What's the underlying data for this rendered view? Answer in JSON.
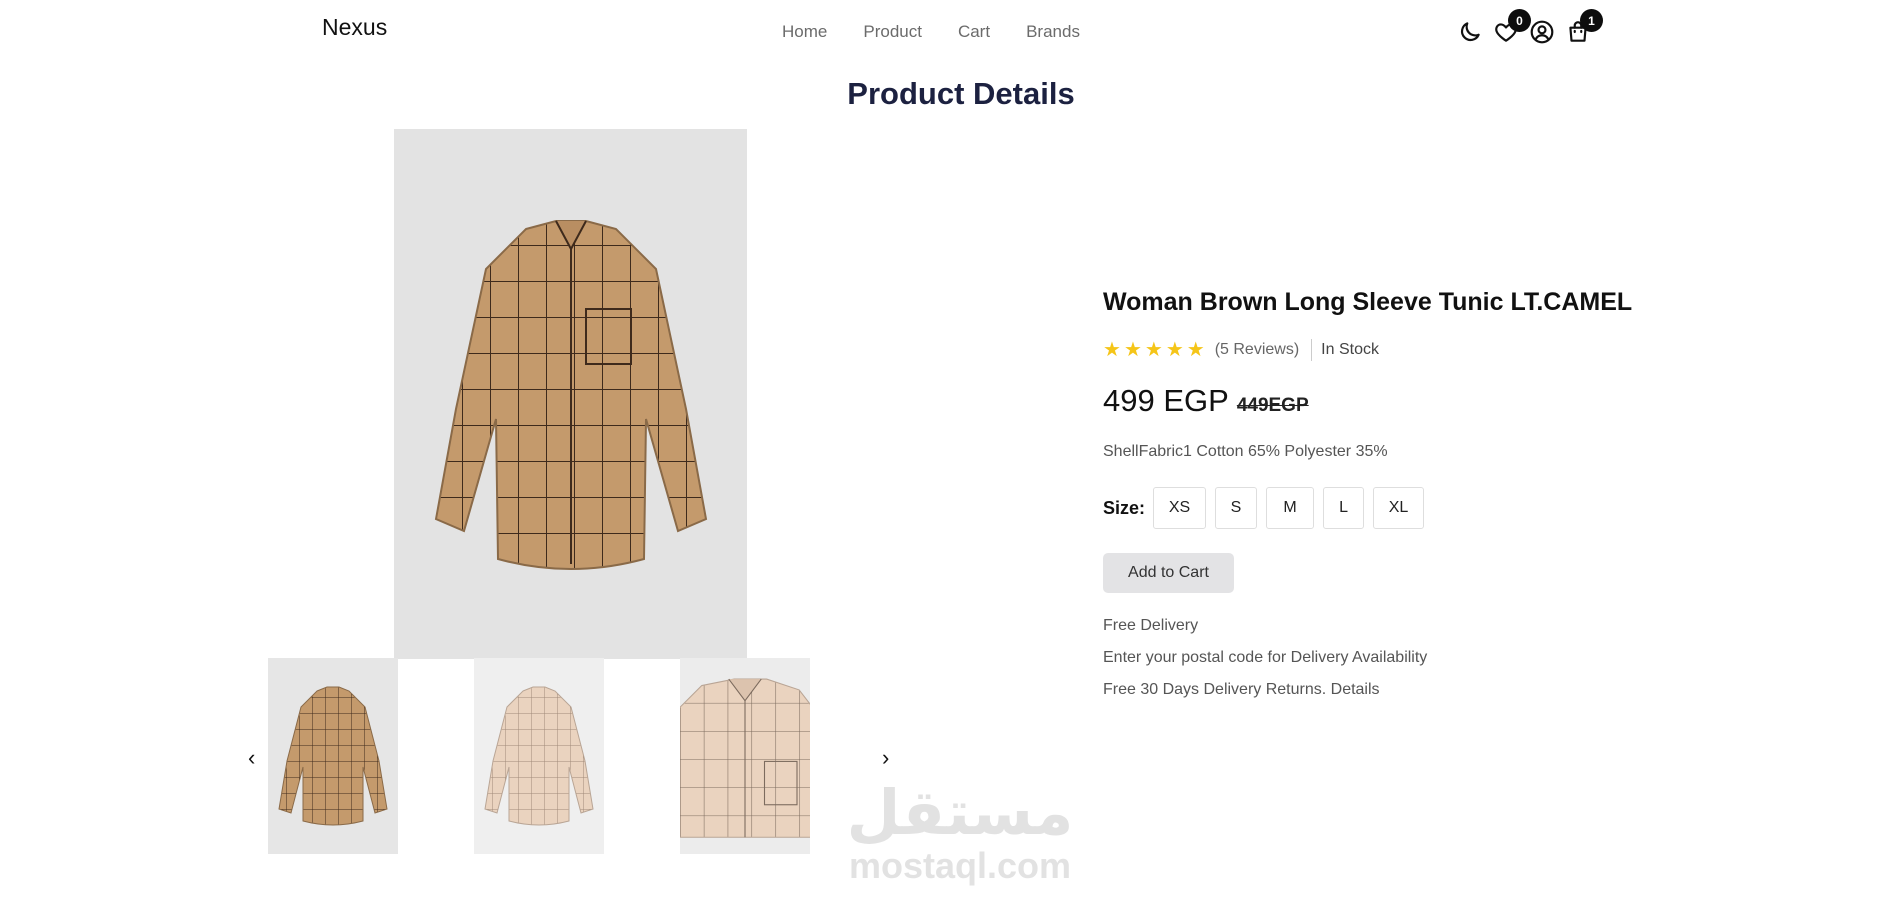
{
  "header": {
    "brand": "Nexus",
    "nav": [
      "Home",
      "Product",
      "Cart",
      "Brands"
    ],
    "wishlist_count": "0",
    "cart_count": "1"
  },
  "page": {
    "title": "Product Details"
  },
  "gallery": {
    "prev_arrow": "‹",
    "next_arrow": "›"
  },
  "product": {
    "title": "Woman Brown Long Sleeve Tunic LT.CAMEL",
    "rating": 5,
    "reviews": "(5 Reviews)",
    "stock": "In Stock",
    "price": "499 EGP",
    "old_price": "449EGP",
    "description": "ShellFabric1 Cotton 65% Polyester 35%",
    "size_label": "Size:",
    "sizes": [
      "XS",
      "S",
      "M",
      "L",
      "XL"
    ],
    "add_to_cart": "Add to Cart",
    "delivery": [
      "Free Delivery",
      "Enter your postal code for Delivery Availability",
      "Free 30 Days Delivery Returns. Details"
    ]
  },
  "watermark": {
    "arabic": "مستقل",
    "latin": "mostaql.com"
  },
  "colors": {
    "title": "#1c2140",
    "star": "#f5c518",
    "shirt_main": "#c49a6c",
    "shirt_light": "#ead3bf"
  }
}
